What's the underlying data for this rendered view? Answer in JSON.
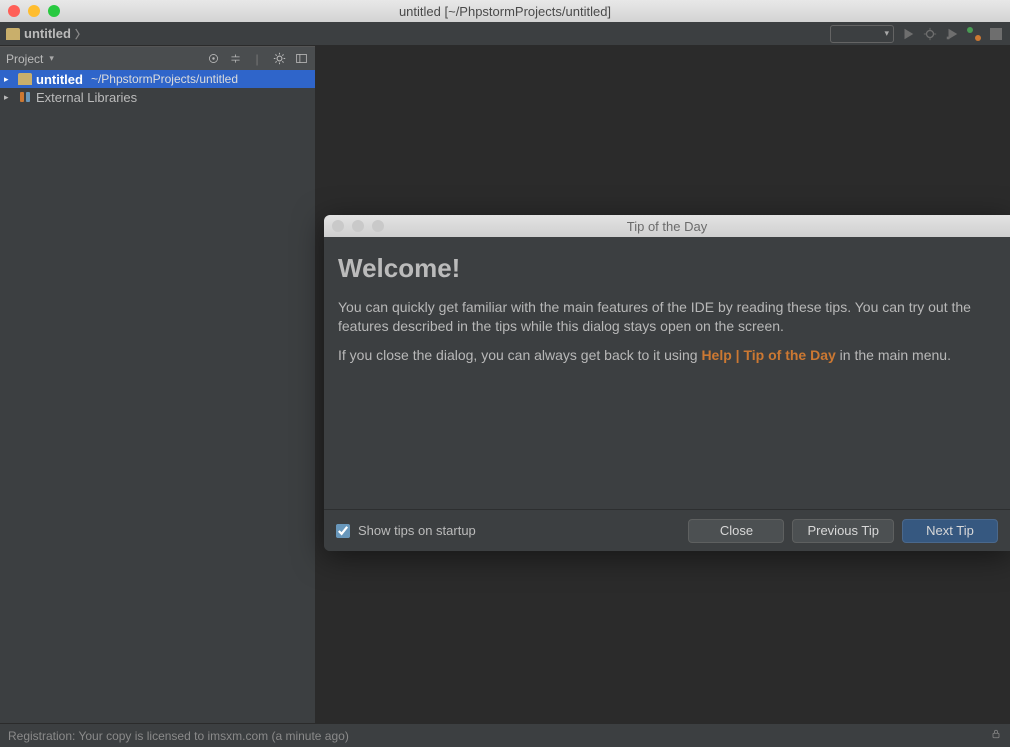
{
  "window": {
    "title": "untitled [~/PhpstormProjects/untitled]"
  },
  "breadcrumb": {
    "project_name": "untitled"
  },
  "project_tool": {
    "title": "Project",
    "tree": {
      "root_name": "untitled",
      "root_path": "~/PhpstormProjects/untitled",
      "external_libs": "External Libraries"
    }
  },
  "dialog": {
    "window_title": "Tip of the Day",
    "heading": "Welcome!",
    "p1": "You can quickly get familiar with the main features of the IDE by reading these tips. You can try out the features described in the tips while this dialog stays open on the screen.",
    "p2_a": "If you close the dialog, you can always get back to it using ",
    "p2_help": "Help",
    "p2_sep": " | ",
    "p2_tip": "Tip of the Day",
    "p2_b": " in the main menu.",
    "show_tips": "Show tips on startup",
    "close": "Close",
    "previous": "Previous Tip",
    "next": "Next Tip"
  },
  "statusbar": {
    "message": "Registration: Your copy is licensed to imsxm.com (a minute ago)"
  }
}
